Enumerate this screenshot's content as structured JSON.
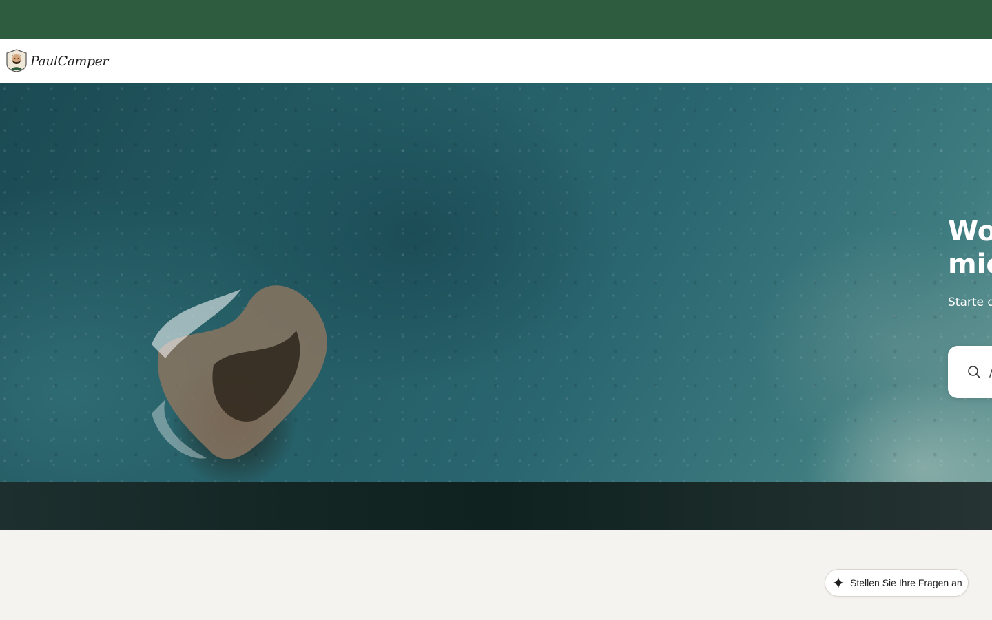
{
  "header": {
    "logo_text": "PaulCamper",
    "logo_icon": "bearded-man-badge-icon"
  },
  "hero": {
    "title_line1": "Wo",
    "title_line2": "mic",
    "subtitle": "Starte d",
    "search": {
      "icon": "search-icon",
      "text": "/"
    }
  },
  "chat": {
    "icon": "sparkle-icon",
    "label": "Stellen Sie Ihre Fragen an"
  },
  "colors": {
    "banner": "#2e5c3f",
    "page_bg": "#f5f3ef",
    "navbar_bg": "#ffffff"
  }
}
